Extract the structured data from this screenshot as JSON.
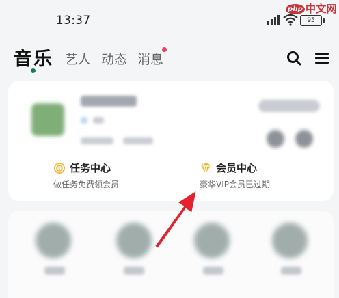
{
  "status_bar": {
    "time": "13:37",
    "battery": "95",
    "watermark_badge": "php",
    "watermark_text": "中文网"
  },
  "nav": {
    "tabs": [
      {
        "label": "音乐",
        "active": true
      },
      {
        "label": "艺人",
        "active": false
      },
      {
        "label": "动态",
        "active": false
      },
      {
        "label": "消息",
        "active": false,
        "badge": true
      }
    ],
    "search_icon": "search-icon",
    "menu_icon": "menu-icon"
  },
  "vip_card": {
    "task_center": {
      "title": "任务中心",
      "desc": "做任务免费领会员",
      "icon": "coin-icon"
    },
    "member_center": {
      "title": "会员中心",
      "desc": "豪华VIP会员已过期",
      "icon": "diamond-icon"
    }
  },
  "colors": {
    "accent_green": "#1b7a5a",
    "badge_red": "#e5405e",
    "arrow_red": "#e3232e",
    "gold": "#e6a62a"
  }
}
